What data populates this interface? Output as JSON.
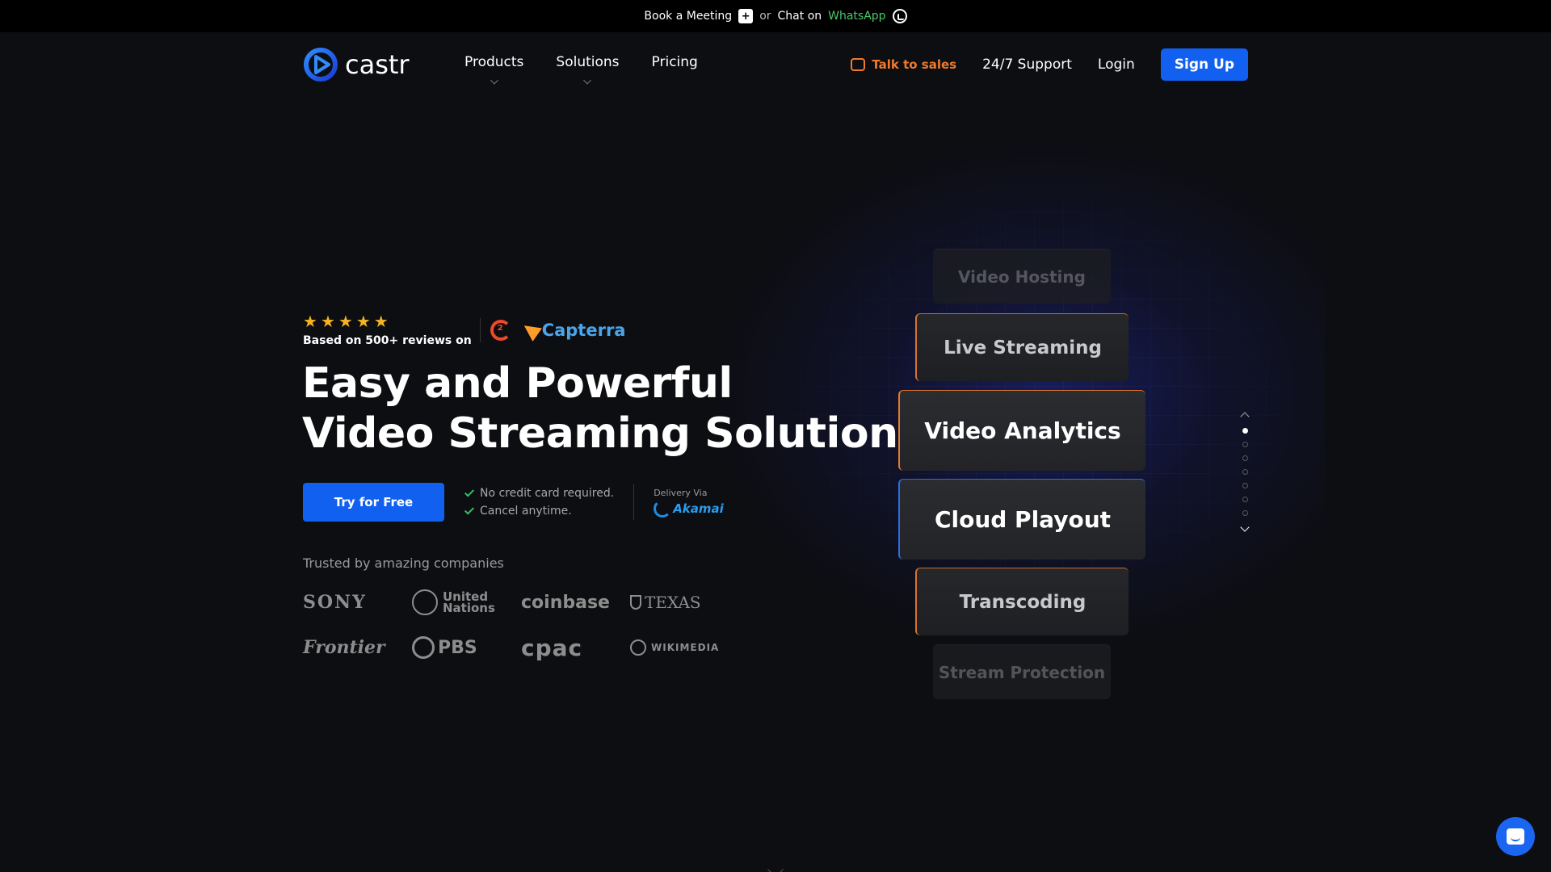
{
  "topbar": {
    "book": "Book a Meeting",
    "or": "or",
    "chat": "Chat on",
    "whatsapp": "WhatsApp"
  },
  "nav": {
    "logo_text": "castr",
    "links": [
      "Products",
      "Solutions",
      "Pricing"
    ],
    "talk_to_sales": "Talk to sales",
    "support": "24/7 Support",
    "login": "Login",
    "signup": "Sign Up"
  },
  "hero": {
    "stars": 5,
    "reviews_text": "Based on 500+ reviews on",
    "capterra": "Capterra",
    "headline_line1": "Easy and Powerful",
    "headline_line2": "Video Streaming Solution",
    "cta": "Try for Free",
    "check1": "No credit card required.",
    "check2": "Cancel anytime.",
    "delivery": "Delivery Via",
    "akamai": "Akamai",
    "trusted": "Trusted by amazing companies"
  },
  "logos": {
    "sony": "SONY",
    "un_line1": "United",
    "un_line2": "Nations",
    "coinbase": "coinbase",
    "texas": "TEXAS",
    "frontier": "Frontier",
    "pbs": "PBS",
    "cpac": "cpac",
    "wikimedia": "WIKIMEDIA"
  },
  "cards": [
    "Video Hosting",
    "Live Streaming",
    "Video Analytics",
    "Cloud Playout",
    "Transcoding",
    "Stream Protection"
  ],
  "pager": {
    "total": 7,
    "active": 0
  },
  "colors": {
    "accent_blue": "#1260f0",
    "accent_orange": "#f07a2c",
    "whatsapp_green": "#4cc76b",
    "background": "#0d0e12"
  }
}
